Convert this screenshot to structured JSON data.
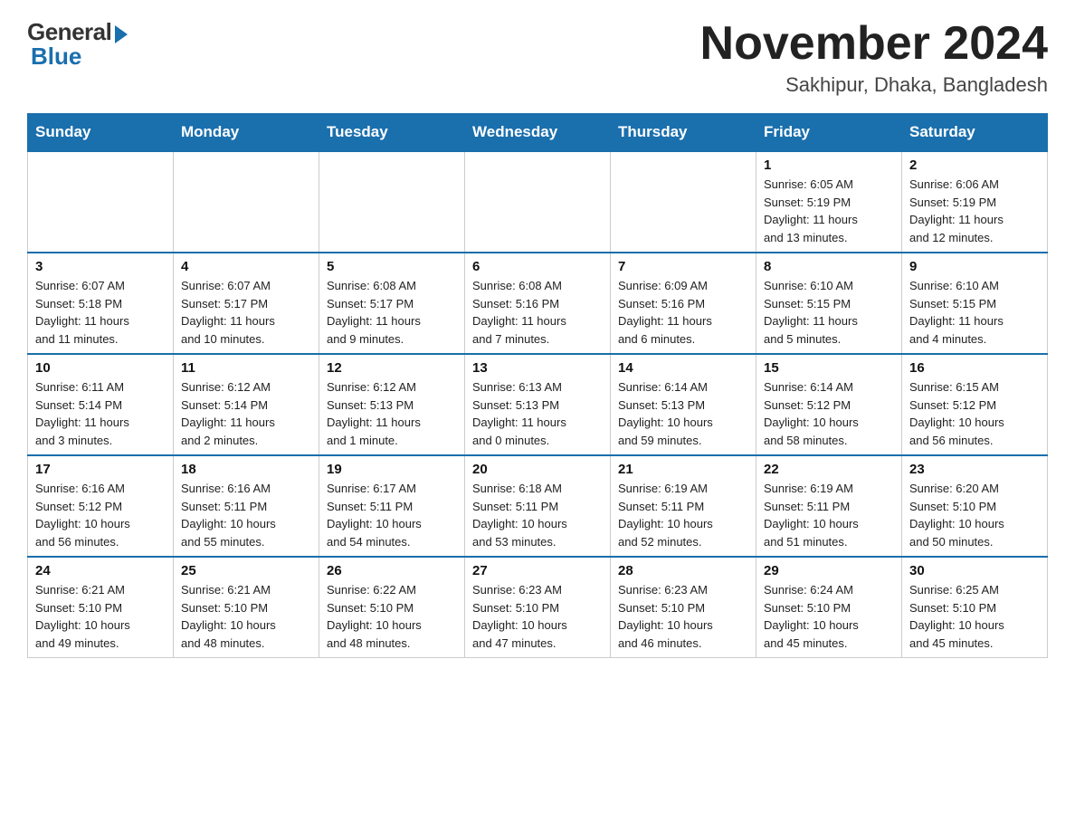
{
  "header": {
    "logo_general": "General",
    "logo_blue": "Blue",
    "month_title": "November 2024",
    "location": "Sakhipur, Dhaka, Bangladesh"
  },
  "weekdays": [
    "Sunday",
    "Monday",
    "Tuesday",
    "Wednesday",
    "Thursday",
    "Friday",
    "Saturday"
  ],
  "weeks": [
    [
      {
        "day": "",
        "info": ""
      },
      {
        "day": "",
        "info": ""
      },
      {
        "day": "",
        "info": ""
      },
      {
        "day": "",
        "info": ""
      },
      {
        "day": "",
        "info": ""
      },
      {
        "day": "1",
        "info": "Sunrise: 6:05 AM\nSunset: 5:19 PM\nDaylight: 11 hours\nand 13 minutes."
      },
      {
        "day": "2",
        "info": "Sunrise: 6:06 AM\nSunset: 5:19 PM\nDaylight: 11 hours\nand 12 minutes."
      }
    ],
    [
      {
        "day": "3",
        "info": "Sunrise: 6:07 AM\nSunset: 5:18 PM\nDaylight: 11 hours\nand 11 minutes."
      },
      {
        "day": "4",
        "info": "Sunrise: 6:07 AM\nSunset: 5:17 PM\nDaylight: 11 hours\nand 10 minutes."
      },
      {
        "day": "5",
        "info": "Sunrise: 6:08 AM\nSunset: 5:17 PM\nDaylight: 11 hours\nand 9 minutes."
      },
      {
        "day": "6",
        "info": "Sunrise: 6:08 AM\nSunset: 5:16 PM\nDaylight: 11 hours\nand 7 minutes."
      },
      {
        "day": "7",
        "info": "Sunrise: 6:09 AM\nSunset: 5:16 PM\nDaylight: 11 hours\nand 6 minutes."
      },
      {
        "day": "8",
        "info": "Sunrise: 6:10 AM\nSunset: 5:15 PM\nDaylight: 11 hours\nand 5 minutes."
      },
      {
        "day": "9",
        "info": "Sunrise: 6:10 AM\nSunset: 5:15 PM\nDaylight: 11 hours\nand 4 minutes."
      }
    ],
    [
      {
        "day": "10",
        "info": "Sunrise: 6:11 AM\nSunset: 5:14 PM\nDaylight: 11 hours\nand 3 minutes."
      },
      {
        "day": "11",
        "info": "Sunrise: 6:12 AM\nSunset: 5:14 PM\nDaylight: 11 hours\nand 2 minutes."
      },
      {
        "day": "12",
        "info": "Sunrise: 6:12 AM\nSunset: 5:13 PM\nDaylight: 11 hours\nand 1 minute."
      },
      {
        "day": "13",
        "info": "Sunrise: 6:13 AM\nSunset: 5:13 PM\nDaylight: 11 hours\nand 0 minutes."
      },
      {
        "day": "14",
        "info": "Sunrise: 6:14 AM\nSunset: 5:13 PM\nDaylight: 10 hours\nand 59 minutes."
      },
      {
        "day": "15",
        "info": "Sunrise: 6:14 AM\nSunset: 5:12 PM\nDaylight: 10 hours\nand 58 minutes."
      },
      {
        "day": "16",
        "info": "Sunrise: 6:15 AM\nSunset: 5:12 PM\nDaylight: 10 hours\nand 56 minutes."
      }
    ],
    [
      {
        "day": "17",
        "info": "Sunrise: 6:16 AM\nSunset: 5:12 PM\nDaylight: 10 hours\nand 56 minutes."
      },
      {
        "day": "18",
        "info": "Sunrise: 6:16 AM\nSunset: 5:11 PM\nDaylight: 10 hours\nand 55 minutes."
      },
      {
        "day": "19",
        "info": "Sunrise: 6:17 AM\nSunset: 5:11 PM\nDaylight: 10 hours\nand 54 minutes."
      },
      {
        "day": "20",
        "info": "Sunrise: 6:18 AM\nSunset: 5:11 PM\nDaylight: 10 hours\nand 53 minutes."
      },
      {
        "day": "21",
        "info": "Sunrise: 6:19 AM\nSunset: 5:11 PM\nDaylight: 10 hours\nand 52 minutes."
      },
      {
        "day": "22",
        "info": "Sunrise: 6:19 AM\nSunset: 5:11 PM\nDaylight: 10 hours\nand 51 minutes."
      },
      {
        "day": "23",
        "info": "Sunrise: 6:20 AM\nSunset: 5:10 PM\nDaylight: 10 hours\nand 50 minutes."
      }
    ],
    [
      {
        "day": "24",
        "info": "Sunrise: 6:21 AM\nSunset: 5:10 PM\nDaylight: 10 hours\nand 49 minutes."
      },
      {
        "day": "25",
        "info": "Sunrise: 6:21 AM\nSunset: 5:10 PM\nDaylight: 10 hours\nand 48 minutes."
      },
      {
        "day": "26",
        "info": "Sunrise: 6:22 AM\nSunset: 5:10 PM\nDaylight: 10 hours\nand 48 minutes."
      },
      {
        "day": "27",
        "info": "Sunrise: 6:23 AM\nSunset: 5:10 PM\nDaylight: 10 hours\nand 47 minutes."
      },
      {
        "day": "28",
        "info": "Sunrise: 6:23 AM\nSunset: 5:10 PM\nDaylight: 10 hours\nand 46 minutes."
      },
      {
        "day": "29",
        "info": "Sunrise: 6:24 AM\nSunset: 5:10 PM\nDaylight: 10 hours\nand 45 minutes."
      },
      {
        "day": "30",
        "info": "Sunrise: 6:25 AM\nSunset: 5:10 PM\nDaylight: 10 hours\nand 45 minutes."
      }
    ]
  ]
}
